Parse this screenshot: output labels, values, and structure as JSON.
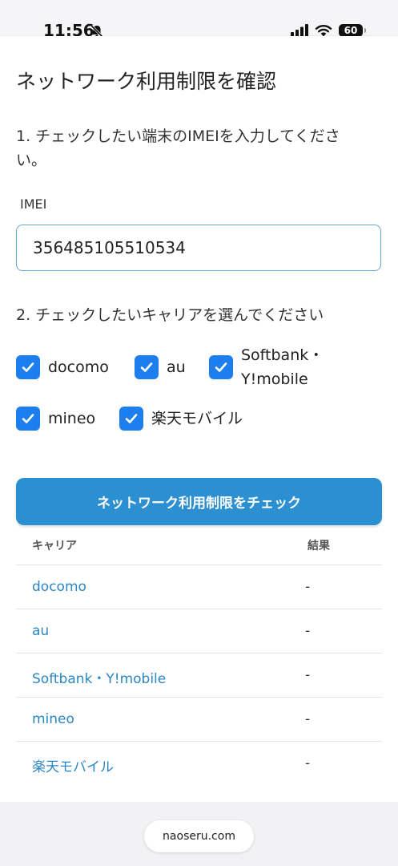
{
  "status_bar": {
    "time": "11:56",
    "battery": "60"
  },
  "page": {
    "title": "ネットワーク利用制限を確認",
    "step1": "1. チェックしたい端末のIMEIを入力してください。",
    "imei_label": "IMEI",
    "imei_value": "356485105510534",
    "step2": "2. チェックしたいキャリアを選んでください",
    "carriers": [
      {
        "label": "docomo",
        "checked": true
      },
      {
        "label": "au",
        "checked": true
      },
      {
        "label": "Softbank・",
        "label2": "Y!mobile",
        "checked": true
      },
      {
        "label": "mineo",
        "checked": true
      },
      {
        "label": "楽天モバイル",
        "checked": true
      }
    ],
    "check_button": "ネットワーク利用制限をチェック",
    "table": {
      "headers": [
        "キャリア",
        "結果"
      ],
      "rows": [
        {
          "carrier": "docomo",
          "result": "-"
        },
        {
          "carrier": "au",
          "result": "-"
        },
        {
          "carrier": "Softbank・Y!mobile",
          "result": "-"
        },
        {
          "carrier": "mineo",
          "result": "-"
        },
        {
          "carrier": "楽天モバイル",
          "result": "-"
        }
      ]
    }
  },
  "browser": {
    "url": "naoseru.com"
  },
  "colors": {
    "accent": "#2b8fd1",
    "checkbox": "#1d7ef0",
    "link": "#2a86c4"
  }
}
